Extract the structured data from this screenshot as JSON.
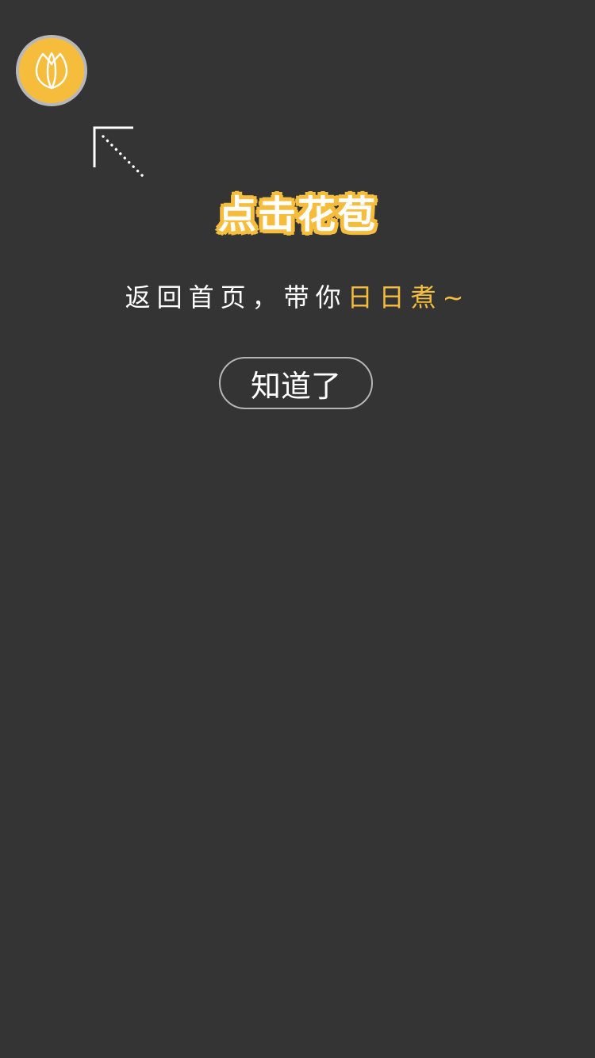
{
  "bud_button": {
    "icon": "tulip-bud-icon",
    "color": "#f6bd3d"
  },
  "pointer": {
    "icon": "dotted-arrow-up-left-icon"
  },
  "tip": {
    "headline": "点击花苞",
    "subline_prefix": "返回首页，带你",
    "subline_accent": "日日煮~"
  },
  "actions": {
    "got_it_label": "知道了"
  },
  "colors": {
    "background": "#343434",
    "accent": "#f6bd3d",
    "text": "#ffffff"
  }
}
